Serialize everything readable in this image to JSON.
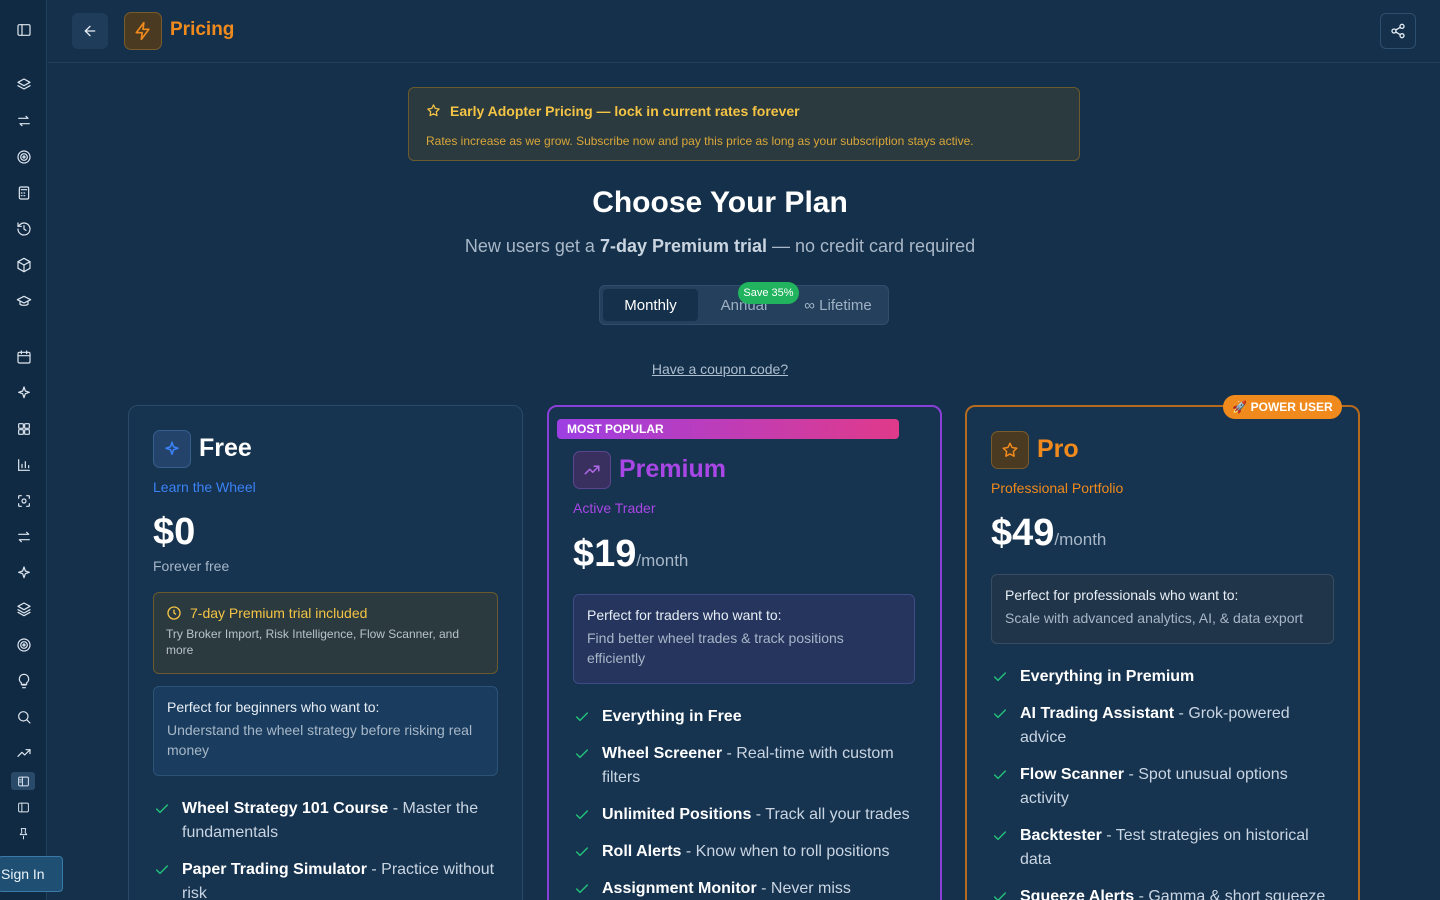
{
  "header": {
    "title": "Pricing"
  },
  "banner": {
    "title": "Early Adopter Pricing — lock in current rates forever",
    "text": "Rates increase as we grow. Subscribe now and pay this price as long as your subscription stays active."
  },
  "hero": {
    "title": "Choose Your Plan",
    "sub_prefix": "New users get a ",
    "sub_bold": "7-day Premium trial",
    "sub_suffix": " — no credit card required"
  },
  "billing": {
    "options": [
      "Monthly",
      "Annual",
      "∞ Lifetime"
    ],
    "selected": "Monthly",
    "save_badge": "Save 35%"
  },
  "coupon_link": "Have a coupon code?",
  "plans": {
    "free": {
      "name": "Free",
      "tagline": "Learn the Wheel",
      "price": "$0",
      "price_note": "Forever free",
      "trial_title": "7-day Premium trial included",
      "trial_text": "Try Broker Import, Risk Intelligence, Flow Scanner, and more",
      "box_title": "Perfect for beginners who want to:",
      "box_text": "Understand the wheel strategy before risking real money",
      "features": [
        {
          "bold": "Wheel Strategy 101 Course",
          "rest": " - Master the fundamentals"
        },
        {
          "bold": "Paper Trading Simulator",
          "rest": " - Practice without risk"
        }
      ]
    },
    "premium": {
      "ribbon": "MOST POPULAR",
      "name": "Premium",
      "tagline": "Active Trader",
      "price": "$19",
      "period": "/month",
      "box_title": "Perfect for traders who want to:",
      "box_text": "Find better wheel trades & track positions efficiently",
      "features": [
        {
          "bold": "Everything in Free",
          "rest": ""
        },
        {
          "bold": "Wheel Screener",
          "rest": " - Real-time with custom filters"
        },
        {
          "bold": "Unlimited Positions",
          "rest": " - Track all your trades"
        },
        {
          "bold": "Roll Alerts",
          "rest": " - Know when to roll positions"
        },
        {
          "bold": "Assignment Monitor",
          "rest": " - Never miss"
        }
      ]
    },
    "pro": {
      "badge": "🚀 POWER USER",
      "name": "Pro",
      "tagline": "Professional Portfolio",
      "price": "$49",
      "period": "/month",
      "box_title": "Perfect for professionals who want to:",
      "box_text": "Scale with advanced analytics, AI, & data export",
      "features": [
        {
          "bold": "Everything in Premium",
          "rest": ""
        },
        {
          "bold": "AI Trading Assistant",
          "rest": " - Grok-powered advice"
        },
        {
          "bold": "Flow Scanner",
          "rest": " - Spot unusual options activity"
        },
        {
          "bold": "Backtester",
          "rest": " - Test strategies on historical data"
        },
        {
          "bold": "Squeeze Alerts",
          "rest": " - Gamma & short squeeze"
        }
      ]
    }
  },
  "sidebar": {
    "signin": "Sign In",
    "icons": [
      "panel-toggle-icon",
      "layers-icon",
      "swap-icon",
      "target-icon",
      "calculator-icon",
      "history-icon",
      "package-icon",
      "graduation-cap-icon",
      "calendar-icon",
      "sparkles-icon",
      "grid-icon",
      "bar-chart-icon",
      "scan-icon",
      "arrows-icon",
      "sparkles-icon",
      "layers-icon",
      "target-icon",
      "lightbulb-icon",
      "search-icon",
      "trending-up-icon"
    ]
  },
  "colors": {
    "background": "#14304a",
    "accent_orange": "#f08a1c",
    "accent_purple": "#9d3fe3",
    "accent_blue": "#3b82f6",
    "check_green": "#22c17a",
    "banner_gold": "#f5c445"
  }
}
